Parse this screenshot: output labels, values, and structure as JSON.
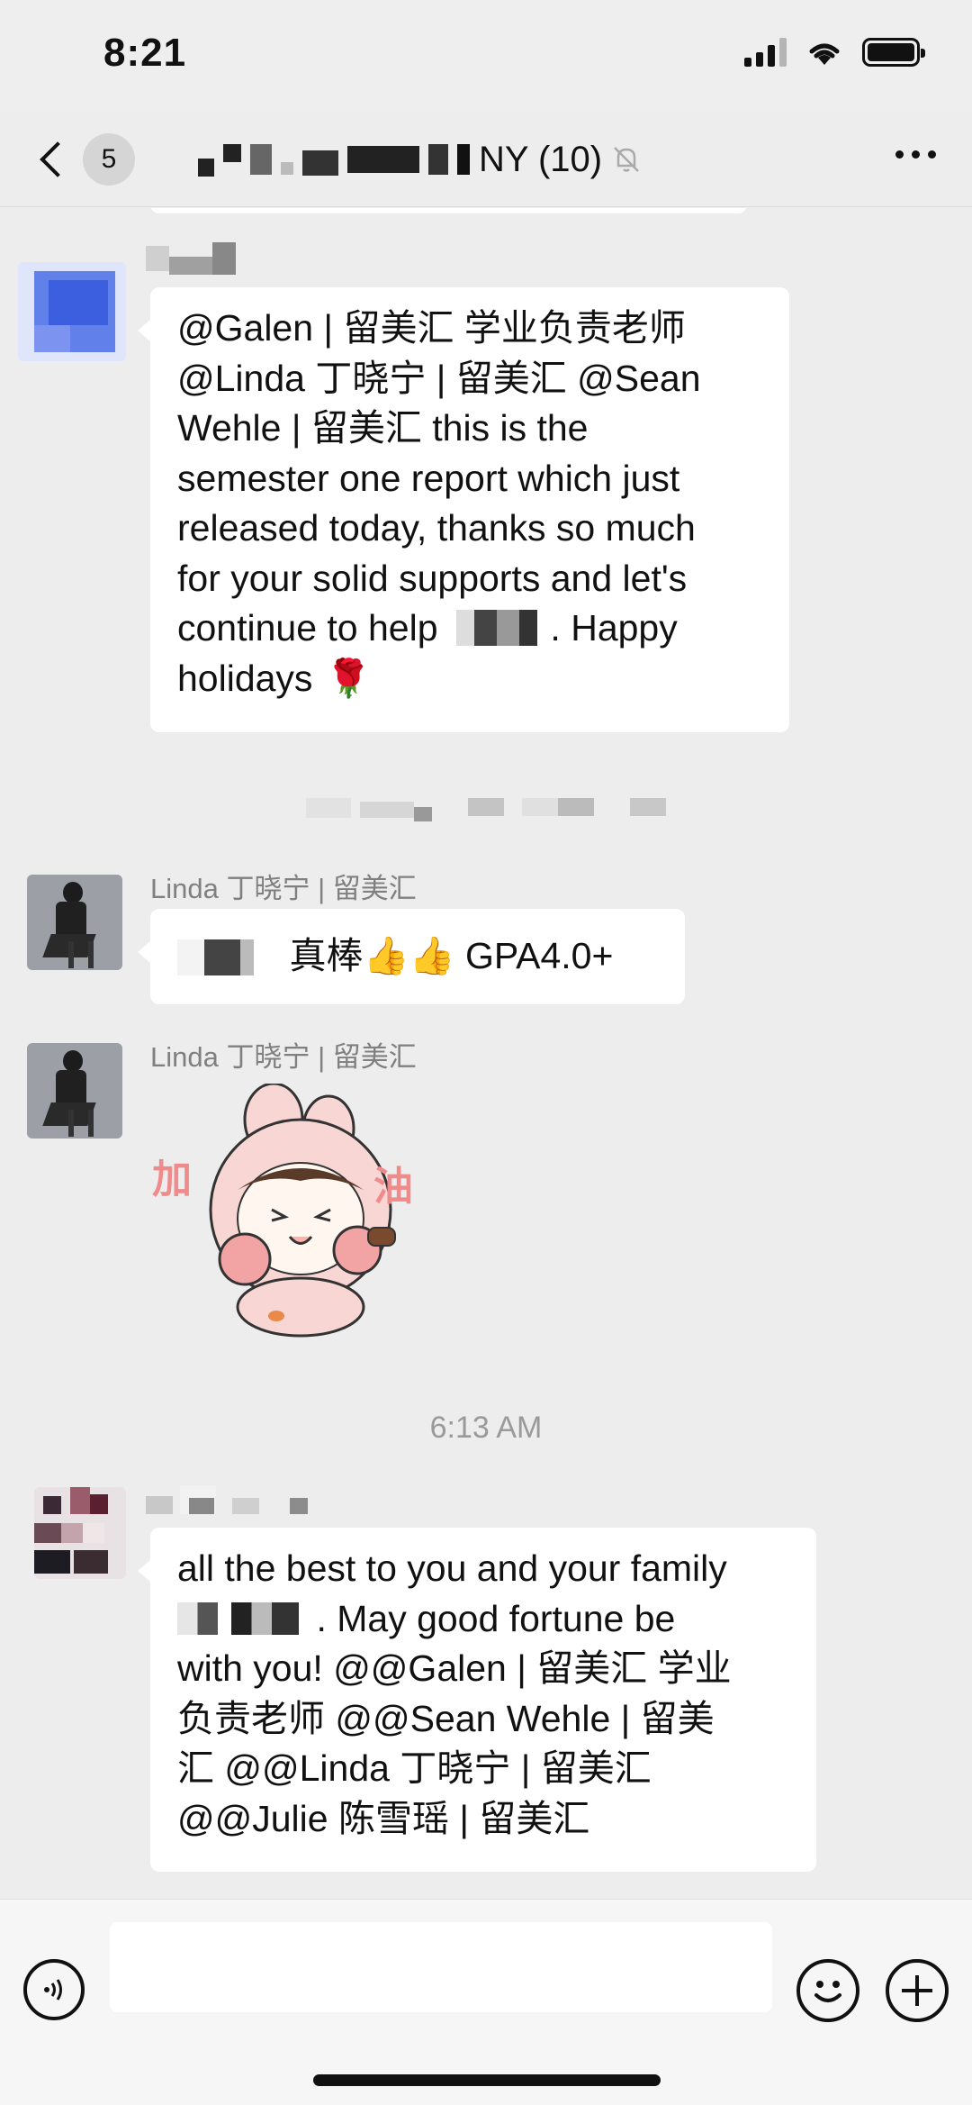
{
  "status_bar": {
    "time": "8:21"
  },
  "nav": {
    "unread_count": "5",
    "title_suffix": "NY (10)"
  },
  "messages": [
    {
      "type": "text",
      "text": "@Galen | 留美汇 学业负责老师\n@Linda 丁晓宁 | 留美汇 @Sean\nWehle | 留美汇 this is the\nsemester one report which just\nreleased today, thanks so much\nfor your solid supports and let's\ncontinue to help",
      "text_tail": ".  Happy\nholidays",
      "emoji": "🌹"
    },
    {
      "type": "text",
      "sender": "Linda 丁晓宁 | 留美汇",
      "text": "真棒👍👍 GPA4.0+"
    },
    {
      "type": "sticker",
      "sender": "Linda 丁晓宁 | 留美汇",
      "sticker_left": "加",
      "sticker_right": "油"
    },
    {
      "type": "timestamp",
      "text": "6:13 AM"
    },
    {
      "type": "text",
      "text_head": "all the best to you and your family",
      "text_after_blur": ". May good fortune be",
      "text": "with you! @@Galen | 留美汇 学业\n负责老师 @@Sean Wehle | 留美\n汇 @@Linda 丁晓宁 | 留美汇\n@@Julie 陈雪瑶 | 留美汇"
    }
  ],
  "input": {
    "placeholder": ""
  },
  "colors": {
    "background": "#ededed",
    "bubble": "#ffffff",
    "meta": "#808080"
  }
}
